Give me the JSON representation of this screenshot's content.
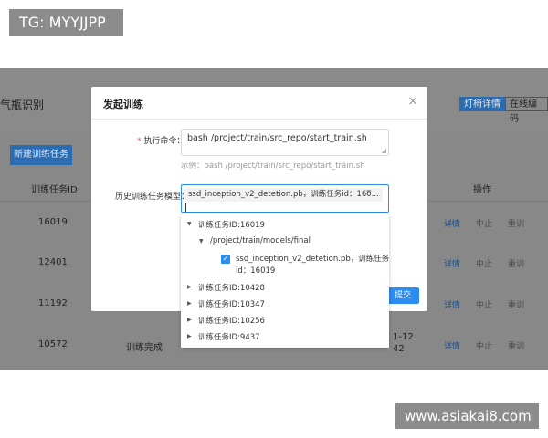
{
  "watermarks": {
    "top_left": "TG: MYYJJPP",
    "bottom_right": "www.asiakai8.com"
  },
  "page": {
    "title_fragment": "气瓶识别",
    "top_buttons": [
      "灯椅详情",
      "在线编码"
    ],
    "new_task_button": "新建训练任务",
    "table": {
      "columns": [
        "训练任务ID",
        "操作"
      ],
      "rows": [
        {
          "id": "16019",
          "actions": [
            "详情",
            "中止",
            "重训"
          ]
        },
        {
          "id": "12401",
          "actions": [
            "详情",
            "中止",
            "重训"
          ]
        },
        {
          "id": "11192",
          "actions": [
            "详情",
            "中止",
            "重训"
          ]
        },
        {
          "id": "10572",
          "status": "训练完成",
          "time_fragment_1": "1-12",
          "time_fragment_2": "42",
          "actions": [
            "详情",
            "中止",
            "重训"
          ]
        }
      ]
    }
  },
  "modal": {
    "title": "发起训练",
    "close_icon": "close-icon",
    "command_label": "执行命令：",
    "command_required_mark": "*",
    "command_value": "bash /project/train/src_repo/start_train.sh",
    "command_example": "示例：bash /project/train/src_repo/start_train.sh",
    "history_label": "历史训练任务模型：",
    "selected_tag": "ssd_inception_v2_detetion.pb，训练任务id：160...",
    "tag_close": "×",
    "submit_label": "提交"
  },
  "dropdown": {
    "nodes": [
      {
        "label": "训练任务ID:16019",
        "expanded": true
      },
      {
        "label": "/project/train/models/final",
        "expanded": true
      },
      {
        "label_line1": "ssd_inception_v2_detetion.pb，训练任务",
        "label_line2": "id：16019",
        "checked": true
      },
      {
        "label": "训练任务ID:10428",
        "expanded": false
      },
      {
        "label": "训练任务ID:10347",
        "expanded": false
      },
      {
        "label": "训练任务ID:10256",
        "expanded": false
      },
      {
        "label": "训练任务ID:9437",
        "expanded": false
      }
    ]
  }
}
